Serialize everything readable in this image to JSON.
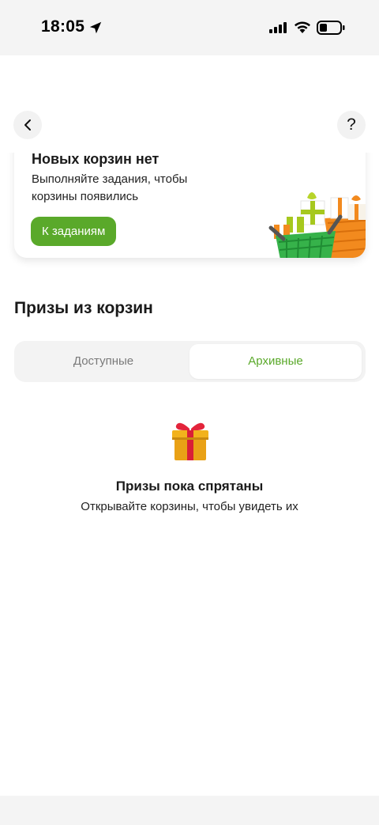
{
  "status_bar": {
    "time": "18:05",
    "icons": [
      "location-arrow-icon",
      "cellular-signal-icon",
      "wifi-icon",
      "battery-icon"
    ]
  },
  "nav": {
    "back_icon": "chevron-left-icon",
    "help_label": "?"
  },
  "empty_baskets_card": {
    "title": "Новых корзин нет",
    "text": "Выполняйте задания, чтобы корзины появились",
    "button_label": "К заданиям",
    "illustration": "gift-baskets-illustration"
  },
  "prizes_section": {
    "title": "Призы из корзин",
    "tabs": [
      {
        "label": "Доступные",
        "selected": false
      },
      {
        "label": "Архивные",
        "selected": true
      }
    ],
    "empty_state": {
      "icon": "gift-icon",
      "title": "Призы пока спрятаны",
      "text": "Открывайте корзины, чтобы увидеть их"
    }
  },
  "colors": {
    "accent": "#5aa92a",
    "status_bar_bg": "#f4f4f4",
    "segment_bg": "#f3f3f3"
  }
}
